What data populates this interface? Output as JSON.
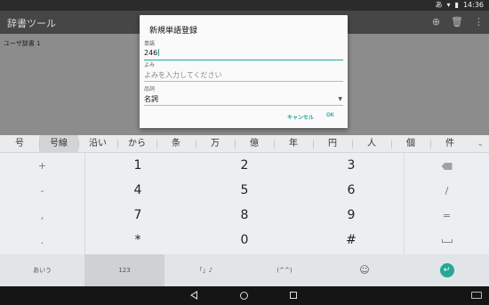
{
  "status_bar": {
    "notification_icon": "あ",
    "time": "14:36"
  },
  "app_bar": {
    "title": "辞書ツール"
  },
  "content": {
    "dictionary_name": "ユーザ辞書 1"
  },
  "dialog": {
    "title": "新規単語登録",
    "word_label": "単語",
    "word_value": "246",
    "reading_label": "よみ",
    "reading_placeholder": "よみを入力してください",
    "pos_label": "品詞",
    "pos_value": "名詞",
    "cancel_label": "キャンセル",
    "ok_label": "OK"
  },
  "candidates": [
    "号",
    "号線",
    "沿い",
    "から",
    "条",
    "万",
    "億",
    "年",
    "円",
    "人",
    "個",
    "件"
  ],
  "keyboard": {
    "left_keys": [
      "+",
      "-",
      ",",
      "."
    ],
    "numpad": [
      [
        "1",
        "2",
        "3"
      ],
      [
        "4",
        "5",
        "6"
      ],
      [
        "7",
        "8",
        "9"
      ],
      [
        "*",
        "0",
        "#"
      ]
    ],
    "right_keys": [
      "/",
      "="
    ],
    "bottom_row": {
      "kana": "あいう",
      "numeric": "123",
      "symbols": "「」♪",
      "kaomoji": "(^^)",
      "enter": "↵"
    }
  },
  "colors": {
    "accent": "#26a69a",
    "status_bar": "#2b2b2b",
    "app_bar": "#464646",
    "keyboard_bg": "#eceff1"
  }
}
